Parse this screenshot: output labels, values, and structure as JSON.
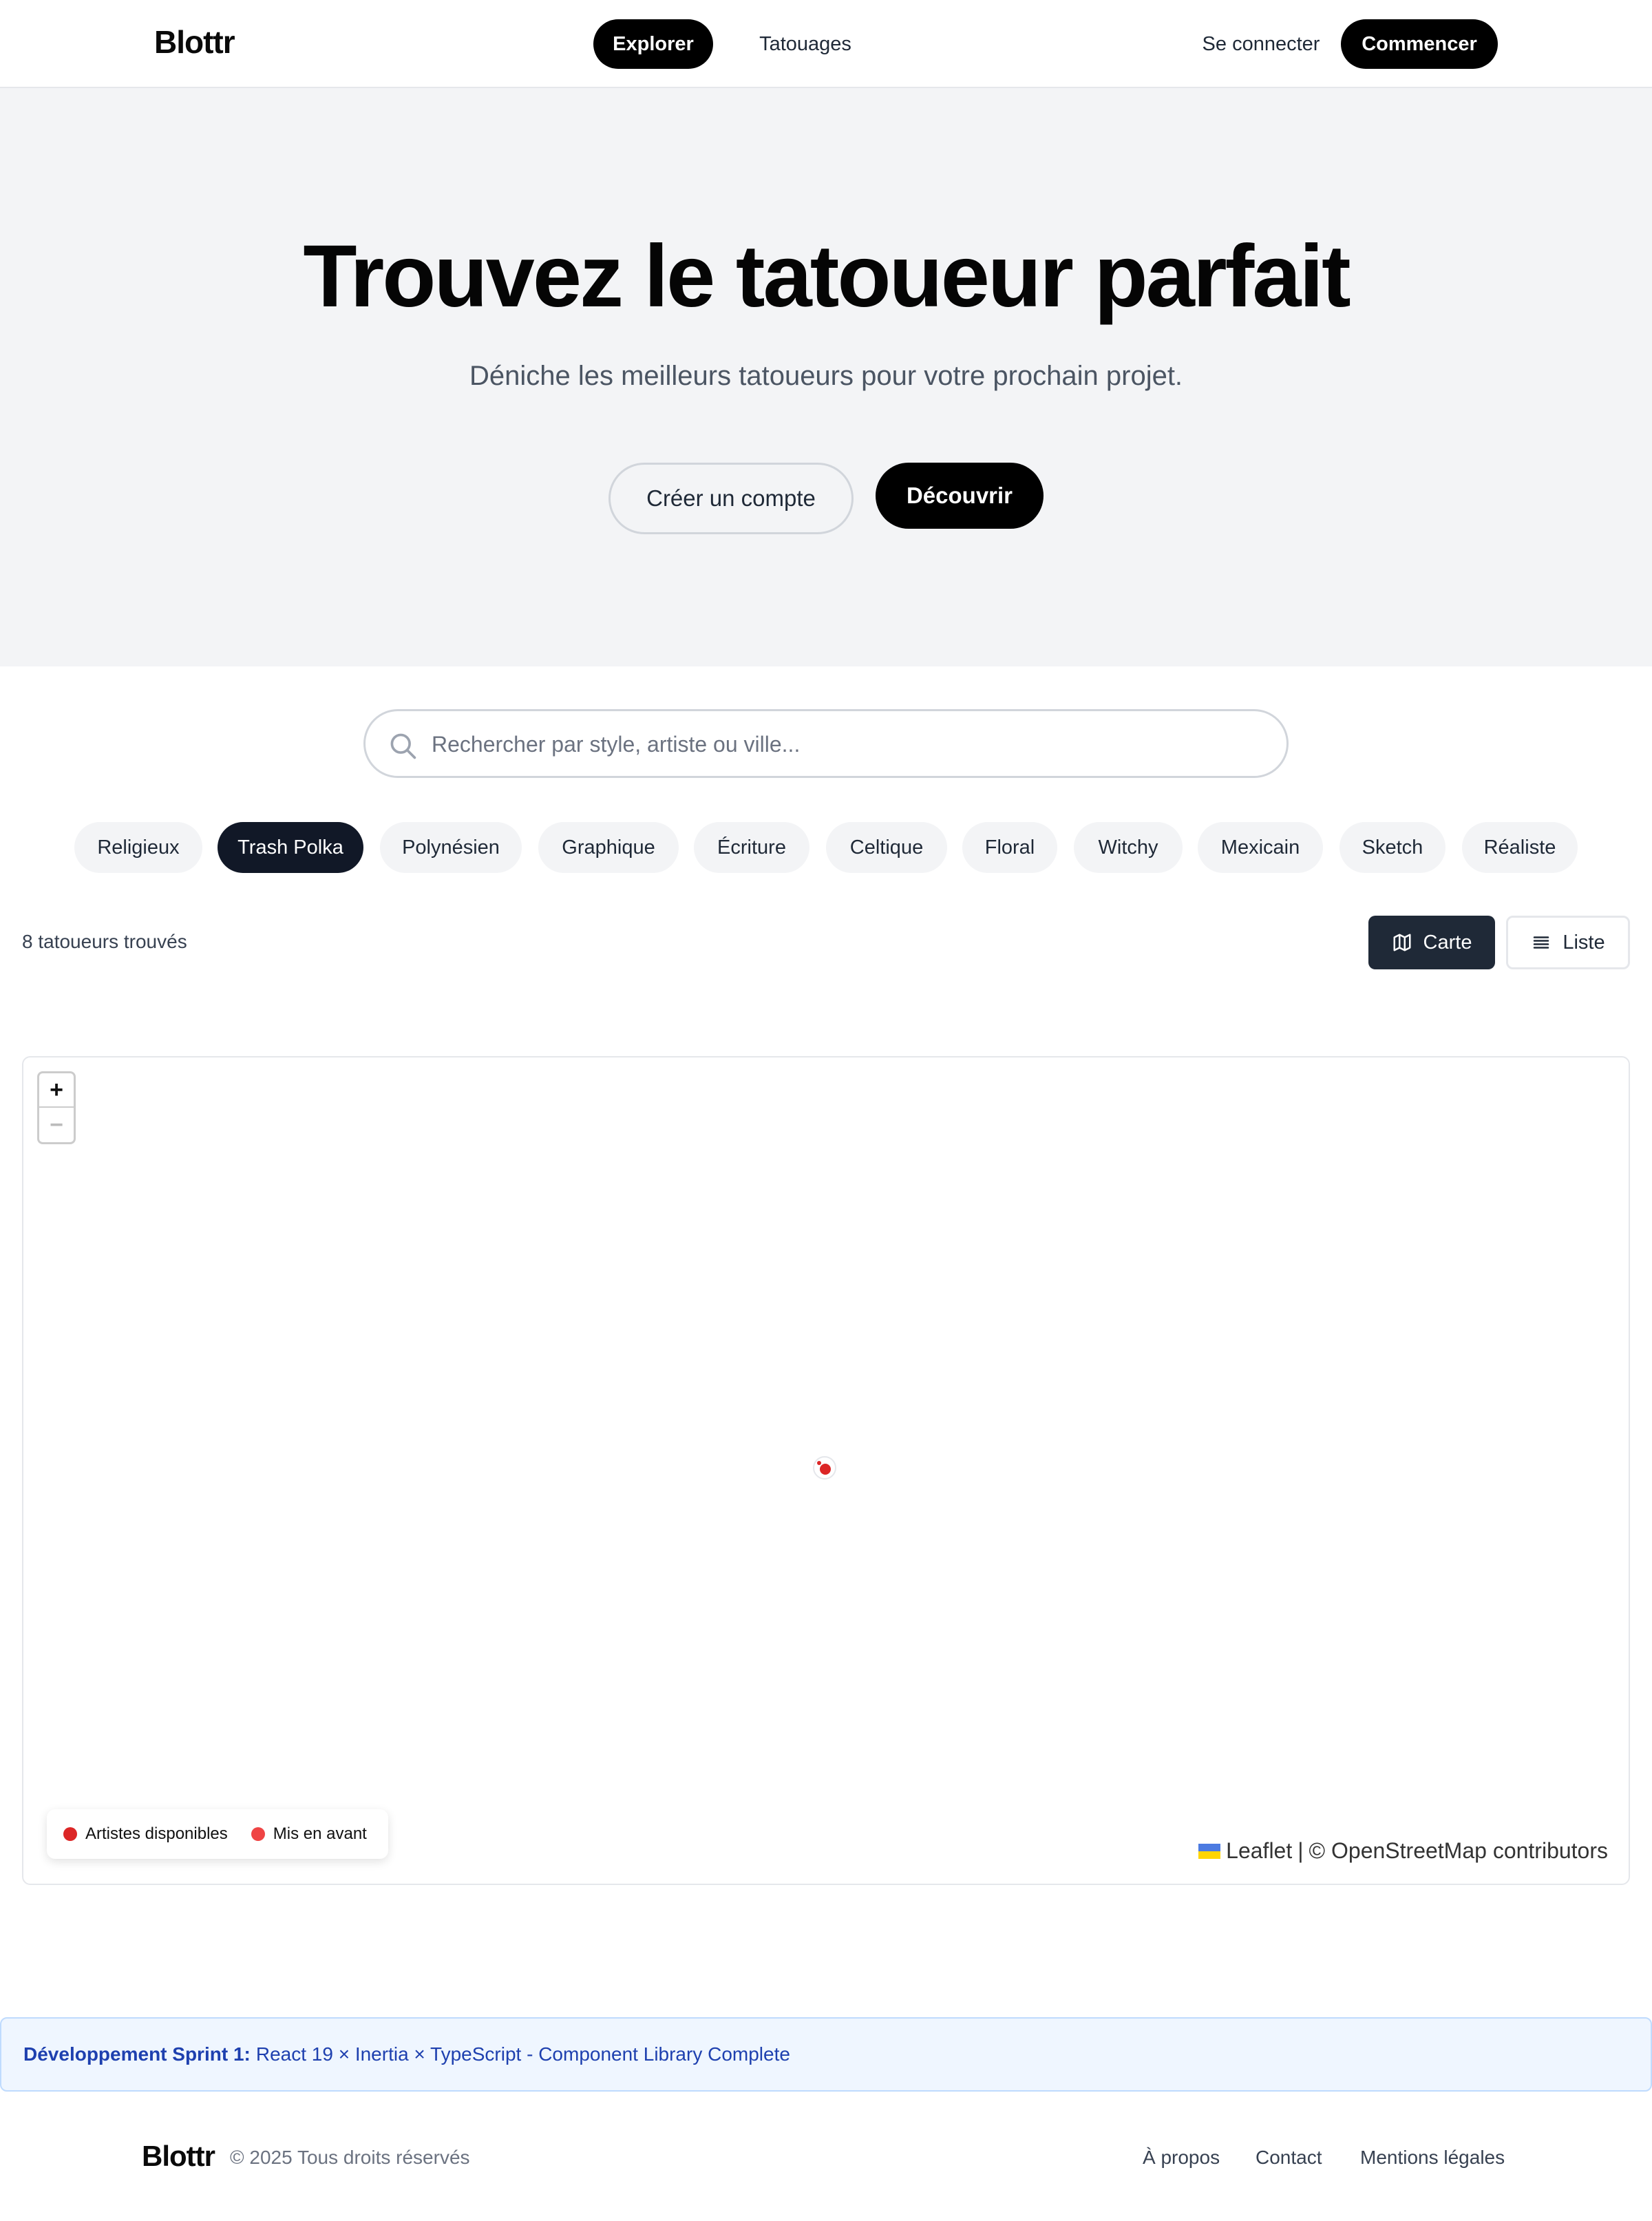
{
  "header": {
    "logo": "Blottr",
    "nav": {
      "explorer": "Explorer",
      "tatouages": "Tatouages"
    },
    "login": "Se connecter",
    "start": "Commencer"
  },
  "hero": {
    "title": "Trouvez le tatoueur parfait",
    "subtitle": "Déniche les meilleurs tatoueurs pour votre prochain projet.",
    "create_account": "Créer un compte",
    "discover": "Découvrir"
  },
  "search": {
    "placeholder": "Rechercher par style, artiste ou ville...",
    "icon": "search-icon"
  },
  "styles": {
    "items": [
      "Religieux",
      "Trash Polka",
      "Polynésien",
      "Graphique",
      "Écriture",
      "Celtique",
      "Floral",
      "Witchy",
      "Mexicain",
      "Sketch",
      "Réaliste"
    ],
    "selected": "Trash Polka"
  },
  "results": {
    "count_text": "8 tatoueurs trouvés",
    "view_map": "Carte",
    "view_list": "Liste",
    "active_view": "Carte"
  },
  "map": {
    "zoom_in": "+",
    "zoom_out": "−",
    "legend": {
      "available": "Artistes disponibles",
      "featured": "Mis en avant"
    },
    "attribution_leaflet": "Leaflet",
    "attribution_sep": "|",
    "attribution_osm": "© OpenStreetMap contributors"
  },
  "dev_banner": {
    "label": "Développement Sprint 1:",
    "text": "React 19 × Inertia × TypeScript - Component Library Complete"
  },
  "footer": {
    "logo": "Blottr",
    "copyright": "© 2025 Tous droits réservés",
    "links": [
      "À propos",
      "Contact",
      "Mentions légales"
    ]
  },
  "colors": {
    "primary": "#000000",
    "dark": "#111827",
    "hero_bg": "#f3f4f6",
    "marker_red": "#dc2626",
    "banner_blue": "#1e40af"
  }
}
